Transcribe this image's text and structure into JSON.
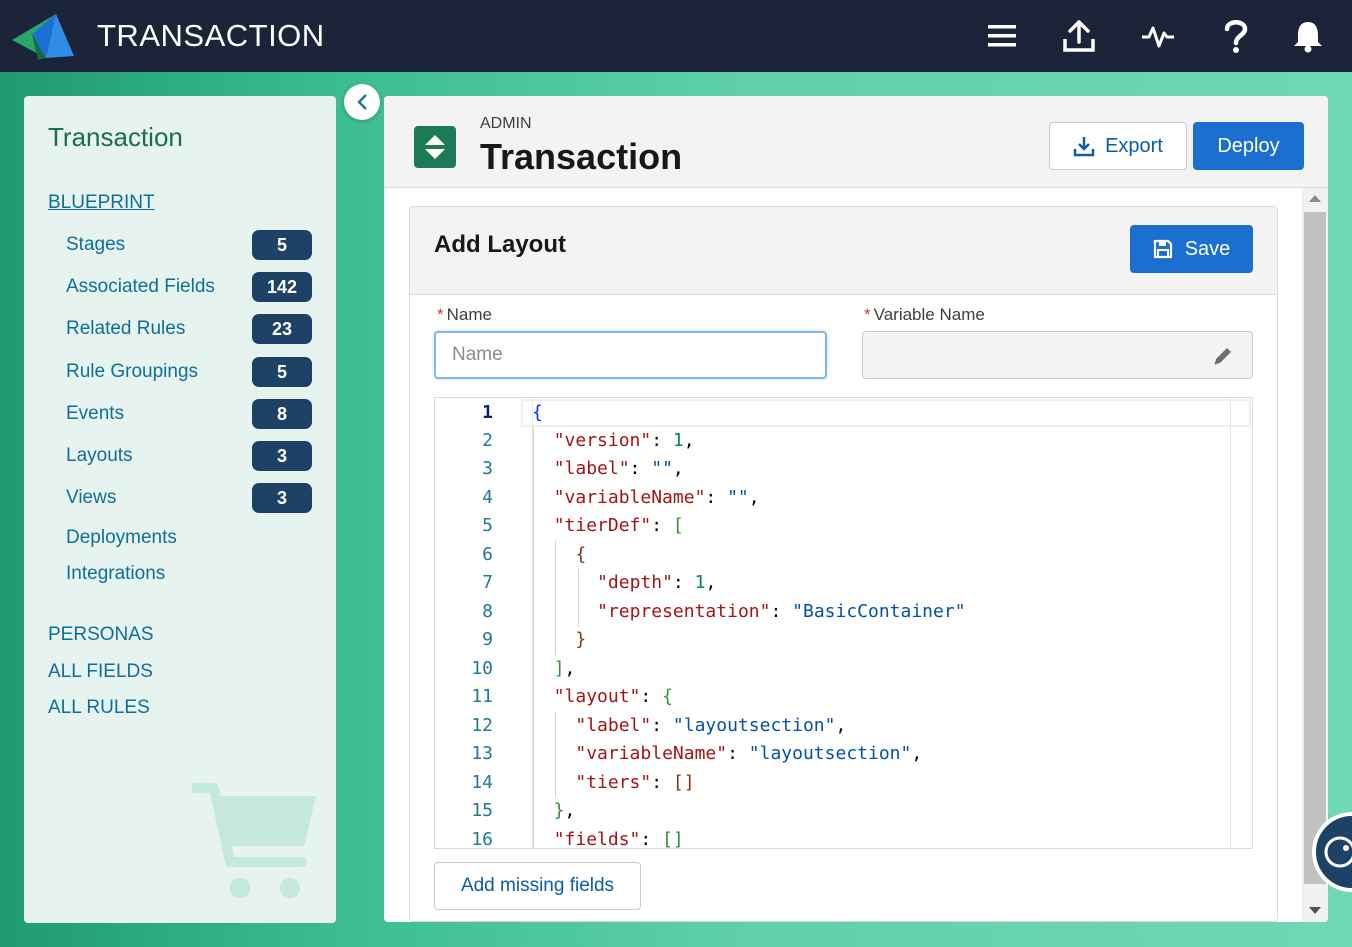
{
  "app": {
    "title": "TRANSACTION",
    "brand_color": "#1b2438",
    "top_icons": [
      "menu-icon",
      "upload-icon",
      "activity-icon",
      "help-icon",
      "bell-icon"
    ]
  },
  "sidebar": {
    "title": "Transaction",
    "blueprint_label": "BLUEPRINT",
    "items": [
      {
        "label": "Stages",
        "count": "5"
      },
      {
        "label": "Associated Fields",
        "count": "142"
      },
      {
        "label": "Related Rules",
        "count": "23"
      },
      {
        "label": "Rule Groupings",
        "count": "5"
      },
      {
        "label": "Events",
        "count": "8"
      },
      {
        "label": "Layouts",
        "count": "3"
      },
      {
        "label": "Views",
        "count": "3"
      },
      {
        "label": "Deployments"
      },
      {
        "label": "Integrations"
      }
    ],
    "sections": [
      "PERSONAS",
      "ALL FIELDS",
      "ALL RULES"
    ]
  },
  "header": {
    "subtitle": "ADMIN",
    "title": "Transaction",
    "export_label": "Export",
    "deploy_label": "Deploy"
  },
  "form": {
    "title": "Add Layout",
    "save_label": "Save",
    "name_label": "Name",
    "name_placeholder": "Name",
    "name_value": "",
    "variable_label": "Variable Name",
    "variable_value": "",
    "required_mark": "*",
    "add_missing_label": "Add missing fields"
  },
  "editor": {
    "active_line": 1,
    "line_numbers": [
      "1",
      "2",
      "3",
      "4",
      "5",
      "6",
      "7",
      "8",
      "9",
      "10",
      "11",
      "12",
      "13",
      "14",
      "15",
      "16"
    ],
    "code_lines": [
      "{",
      "  \"version\": 1,",
      "  \"label\": \"\",",
      "  \"variableName\": \"\",",
      "  \"tierDef\": [",
      "    {",
      "      \"depth\": 1,",
      "      \"representation\": \"BasicContainer\"",
      "    }",
      "  ],",
      "  \"layout\": {",
      "    \"label\": \"layoutsection\",",
      "    \"variableName\": \"layoutsection\",",
      "    \"tiers\": []",
      "  },",
      "  \"fields\": []"
    ]
  }
}
